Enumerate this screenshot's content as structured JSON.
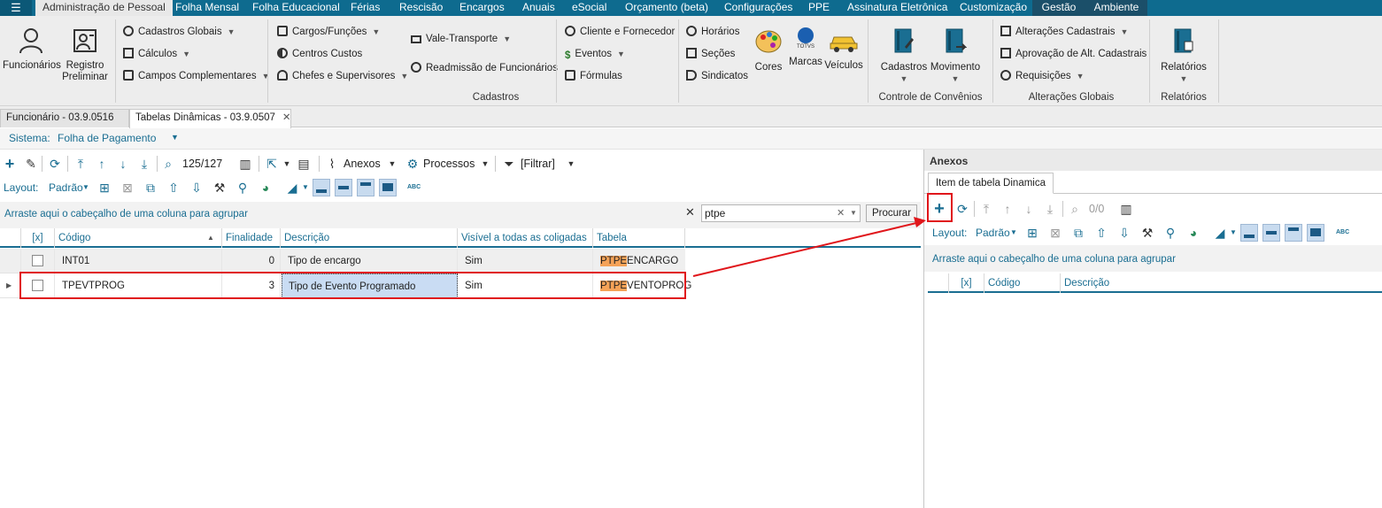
{
  "menu": {
    "app_icon": "menu-icon",
    "tabs": [
      "Administração de Pessoal",
      "Folha Mensal",
      "Folha Educacional",
      "Férias",
      "Rescisão",
      "Encargos",
      "Anuais",
      "eSocial",
      "Orçamento (beta)",
      "Configurações",
      "PPE",
      "Assinatura Eletrônica",
      "Customização",
      "Gestão",
      "Ambiente"
    ],
    "active_tab": "Administração de Pessoal"
  },
  "ribbon": {
    "funcionarios": "Funcionários",
    "registro_l1": "Registro",
    "registro_l2": "Preliminar",
    "cadastros_globais": "Cadastros Globais",
    "calculos": "Cálculos",
    "campos_complementares": "Campos Complementares",
    "cargos_funcoes": "Cargos/Funções",
    "centros_custos": "Centros Custos",
    "chefes_supervisores": "Chefes e Supervisores",
    "vale_transporte": "Vale-Transporte",
    "readmissao": "Readmissão de Funcionários",
    "cliente_fornecedor": "Cliente e Fornecedor",
    "eventos": "Eventos",
    "formulas": "Fórmulas",
    "horarios": "Horários",
    "secoes": "Seções",
    "sindicatos": "Sindicatos",
    "cores": "Cores",
    "marcas": "Marcas",
    "marcas_logo": "TOTVS",
    "veiculos": "Veículos",
    "group_cadastros": "Cadastros",
    "cadastros_btn": "Cadastros",
    "movimento_btn": "Movimento",
    "group_convenios": "Controle de Convênios",
    "alteracoes_cadastrais": "Alterações Cadastrais",
    "aprovacao": "Aprovação de Alt. Cadastrais",
    "requisicoes": "Requisições",
    "group_alteracoes": "Alterações Globais",
    "relatorios_btn": "Relatórios",
    "group_relatorios": "Relatórios"
  },
  "doctabs": [
    {
      "label": "Funcionário - 03.9.0516"
    },
    {
      "label": "Tabelas Dinâmicas - 03.9.0507"
    }
  ],
  "sistema": {
    "label": "Sistema:",
    "value": "Folha de Pagamento"
  },
  "left": {
    "record_count": "125/127",
    "anexos": "Anexos",
    "processos": "Processos",
    "filtrar": "[Filtrar]",
    "layout_label": "Layout:",
    "layout_value": "Padrão",
    "abc": "ABC",
    "group_hint": "Arraste aqui o cabeçalho de uma coluna para agrupar",
    "search_value": "ptpe",
    "procurar": "Procurar",
    "columns": [
      "[x]",
      "Código",
      "Finalidade",
      "Descrição",
      "Visível a todas as coligadas",
      "Tabela"
    ],
    "rows": [
      {
        "codigo": "INT01",
        "finalidade": "0",
        "descricao": "Tipo de encargo",
        "visivel": "Sim",
        "tabela_hl": "PTPE",
        "tabela_rest": "ENCARGO"
      },
      {
        "codigo": "TPEVTPROG",
        "finalidade": "3",
        "descricao": "Tipo de Evento Programado",
        "visivel": "Sim",
        "tabela_hl": "PTPE",
        "tabela_rest": "VENTOPROG"
      }
    ]
  },
  "right": {
    "title": "Anexos",
    "tab": "Item de tabela Dinamica",
    "record_count": "0/0",
    "layout_label": "Layout:",
    "layout_value": "Padrão",
    "abc": "ABC",
    "group_hint": "Arraste aqui o cabeçalho de uma coluna para agrupar",
    "columns": [
      "[x]",
      "Código",
      "Descrição"
    ]
  },
  "colors": {
    "menubar": "#0e6b8f",
    "accent": "#1a6e92",
    "highlight_red": "#e0161b",
    "search_highlight": "#f5a257",
    "selected_cell": "#c9dcf3"
  }
}
